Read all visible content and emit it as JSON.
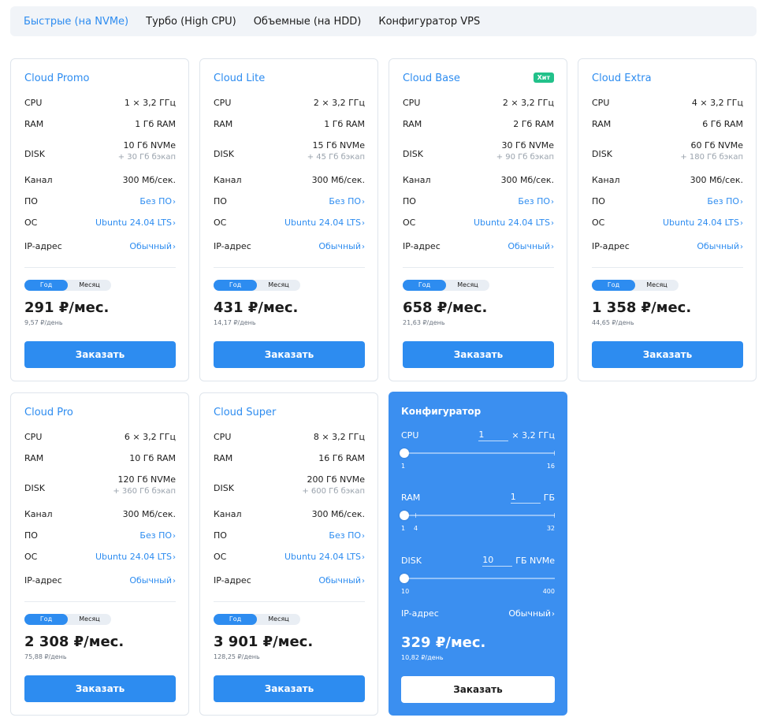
{
  "tabs": [
    {
      "label": "Быстрые (на NVMe)",
      "active": true
    },
    {
      "label": "Турбо (High CPU)",
      "active": false
    },
    {
      "label": "Объемные (на HDD)",
      "active": false
    },
    {
      "label": "Конфигуратор VPS",
      "active": false
    }
  ],
  "spec_labels": {
    "cpu": "CPU",
    "ram": "RAM",
    "disk": "DISK",
    "channel": "Канал",
    "software": "ПО",
    "os": "ОС",
    "ip": "IP-адрес"
  },
  "billing_toggle": {
    "year": "Год",
    "month": "Месяц",
    "selected": "year"
  },
  "order_label": "Заказать",
  "badges": {
    "hit": "Хит"
  },
  "plans": [
    {
      "name": "Cloud Promo",
      "cpu": "1 × 3,2 ГГц",
      "ram": "1 Гб RAM",
      "disk": "10 Гб NVMe",
      "backup": "+ 30 Гб бэкап",
      "channel": "300 Мб/сек.",
      "software": "Без ПО",
      "os": "Ubuntu 24.04 LTS",
      "ip": "Обычный",
      "price": "291 ₽/мес.",
      "per_day": "9,57 ₽/день",
      "hit": false
    },
    {
      "name": "Cloud Lite",
      "cpu": "2 × 3,2 ГГц",
      "ram": "1 Гб RAM",
      "disk": "15 Гб NVMe",
      "backup": "+ 45 Гб бэкап",
      "channel": "300 Мб/сек.",
      "software": "Без ПО",
      "os": "Ubuntu 24.04 LTS",
      "ip": "Обычный",
      "price": "431 ₽/мес.",
      "per_day": "14,17 ₽/день",
      "hit": false
    },
    {
      "name": "Cloud Base",
      "cpu": "2 × 3,2 ГГц",
      "ram": "2 Гб RAM",
      "disk": "30 Гб NVMe",
      "backup": "+ 90 Гб бэкап",
      "channel": "300 Мб/сек.",
      "software": "Без ПО",
      "os": "Ubuntu 24.04 LTS",
      "ip": "Обычный",
      "price": "658 ₽/мес.",
      "per_day": "21,63 ₽/день",
      "hit": true
    },
    {
      "name": "Cloud Extra",
      "cpu": "4 × 3,2 ГГц",
      "ram": "6 Гб RAM",
      "disk": "60 Гб NVMe",
      "backup": "+ 180 Гб бэкап",
      "channel": "300 Мб/сек.",
      "software": "Без ПО",
      "os": "Ubuntu 24.04 LTS",
      "ip": "Обычный",
      "price": "1 358 ₽/мес.",
      "per_day": "44,65 ₽/день",
      "hit": false
    },
    {
      "name": "Cloud Pro",
      "cpu": "6 × 3,2 ГГц",
      "ram": "10 Гб RAM",
      "disk": "120 Гб NVMe",
      "backup": "+ 360 Гб бэкап",
      "channel": "300 Мб/сек.",
      "software": "Без ПО",
      "os": "Ubuntu 24.04 LTS",
      "ip": "Обычный",
      "price": "2 308 ₽/мес.",
      "per_day": "75,88 ₽/день",
      "hit": false
    },
    {
      "name": "Cloud Super",
      "cpu": "8 × 3,2 ГГц",
      "ram": "16 Гб RAM",
      "disk": "200 Гб NVMe",
      "backup": "+ 600 Гб бэкап",
      "channel": "300 Мб/сек.",
      "software": "Без ПО",
      "os": "Ubuntu 24.04 LTS",
      "ip": "Обычный",
      "price": "3 901 ₽/мес.",
      "per_day": "128,25 ₽/день",
      "hit": false
    }
  ],
  "configurator": {
    "title": "Конфигуратор",
    "cpu": {
      "label": "CPU",
      "value": "1",
      "unit": "× 3,2 ГГц",
      "min": "1",
      "max": "16",
      "level": 0
    },
    "ram": {
      "label": "RAM",
      "value": "1",
      "unit": "ГБ",
      "min": "1",
      "mid": "4",
      "max": "32",
      "level": 0
    },
    "disk": {
      "label": "DISK",
      "value": "10",
      "unit": "ГБ NVMe",
      "min": "10",
      "max": "400",
      "level": 0
    },
    "ip": {
      "label": "IP-адрес",
      "value": "Обычный"
    },
    "price": "329 ₽/мес.",
    "per_day": "10,82 ₽/день",
    "order_label": "Заказать"
  },
  "colors": {
    "accent": "#2d8cf0",
    "hit_badge": "#22c18a",
    "configurator_bg": "#3b8ff0"
  }
}
